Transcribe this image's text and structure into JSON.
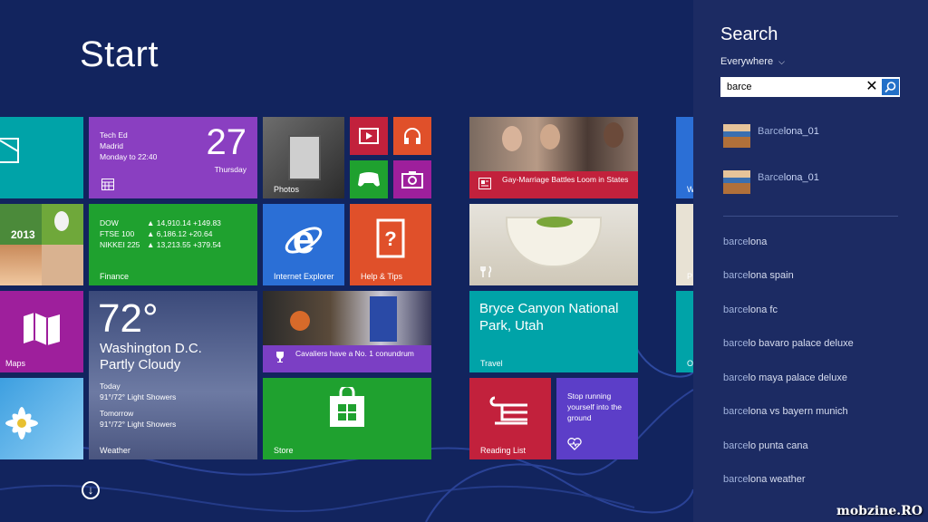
{
  "start": {
    "title": "Start"
  },
  "tiles": {
    "calendar": {
      "event": "Tech Ed",
      "location": "Madrid",
      "time": "Monday to 22:40",
      "day": "27",
      "weekday": "Thursday"
    },
    "photos": {
      "label": "Photos"
    },
    "news": {
      "headline": "Gay-Marriage Battles Loom in States"
    },
    "people_year": "2013",
    "finance": {
      "label": "Finance",
      "rows": [
        {
          "name": "DOW",
          "value": "▲ 14,910.14 +149.83"
        },
        {
          "name": "FTSE 100",
          "value": "▲ 6,186.12 +20.64"
        },
        {
          "name": "NIKKEI 225",
          "value": "▲ 13,213.55 +379.54"
        }
      ]
    },
    "ie": {
      "label": "Internet Explorer"
    },
    "help": {
      "label": "Help & Tips"
    },
    "maps": {
      "label": "Maps"
    },
    "weather": {
      "label": "Weather",
      "temp": "72°",
      "city": "Washington D.C.",
      "cond": "Partly Cloudy",
      "today": "Today",
      "today_fc": "91°/72° Light Showers",
      "tomorrow": "Tomorrow",
      "tomorrow_fc": "91°/72° Light Showers"
    },
    "sports": {
      "headline": "Cavaliers have a No. 1 conundrum"
    },
    "travel": {
      "label": "Travel",
      "title": "Bryce Canyon National Park, Utah"
    },
    "store": {
      "label": "Store"
    },
    "reading": {
      "label": "Reading List"
    },
    "health": {
      "text": "Stop running yourself into the ground"
    },
    "edge1": "W",
    "edge2": "P",
    "edge3": "O"
  },
  "search": {
    "title": "Search",
    "scope": "Everywhere",
    "query": "barce",
    "results": [
      {
        "prefix": "Barce",
        "rest": "lona_01"
      },
      {
        "prefix": "Barce",
        "rest": "lona_01"
      }
    ],
    "suggestions": [
      {
        "prefix": "barce",
        "rest": "lona"
      },
      {
        "prefix": "barce",
        "rest": "lona spain"
      },
      {
        "prefix": "barce",
        "rest": "lona fc"
      },
      {
        "prefix": "barce",
        "rest": "lo bavaro palace deluxe"
      },
      {
        "prefix": "barce",
        "rest": "lo maya palace deluxe"
      },
      {
        "prefix": "barce",
        "rest": "lona vs bayern munich"
      },
      {
        "prefix": "barce",
        "rest": "lo punta cana"
      },
      {
        "prefix": "barce",
        "rest": "lona weather"
      }
    ]
  },
  "watermark": "mobzine.RO",
  "colors": {
    "background": "#12245e",
    "pane": "#1c2b63",
    "teal": "#00a3a8",
    "purple": "#8a3fc1",
    "green": "#1fa12f",
    "orange": "#e0502a",
    "magenta": "#9e1f9c",
    "blue": "#2b6fd6",
    "red": "#c2213c",
    "indigo": "#5c3ec8"
  }
}
